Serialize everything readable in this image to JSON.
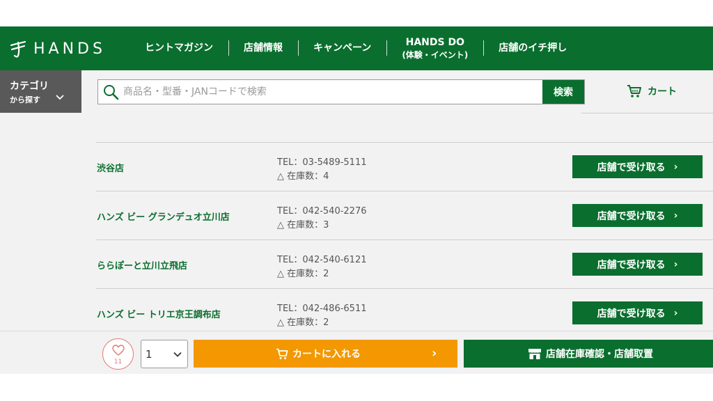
{
  "brand": {
    "logo_text": "HANDS"
  },
  "nav": {
    "items": [
      {
        "label": "ヒントマガジン",
        "sub": ""
      },
      {
        "label": "店舗情報",
        "sub": ""
      },
      {
        "label": "キャンペーン",
        "sub": ""
      },
      {
        "label": "HANDS DO",
        "sub": "(体験・イベント)"
      },
      {
        "label": "店舗のイチ押し",
        "sub": ""
      }
    ]
  },
  "category": {
    "line1": "カテゴリ",
    "line2": "から探す"
  },
  "search": {
    "placeholder": "商品名・型番・JANコードで検索",
    "value": "",
    "button_label": "検索"
  },
  "cart_link": {
    "label": "カート"
  },
  "stores": [
    {
      "name": "渋谷店",
      "tel": "TEL：03-5489-5111",
      "stock": "△ 在庫数：4",
      "button_label": "店舗で受け取る"
    },
    {
      "name": "ハンズ ビー グランデュオ立川店",
      "tel": "TEL：042-540-2276",
      "stock": "△ 在庫数：3",
      "button_label": "店舗で受け取る"
    },
    {
      "name": "ららぽーと立川立飛店",
      "tel": "TEL：042-540-6121",
      "stock": "△ 在庫数：2",
      "button_label": "店舗で受け取る"
    },
    {
      "name": "ハンズ ビー トリエ京王調布店",
      "tel": "TEL：042-486-6511",
      "stock": "△ 在庫数：2",
      "button_label": "店舗で受け取る"
    }
  ],
  "bottom_bar": {
    "favorite_count": "11",
    "quantity": "1",
    "add_to_cart_label": "カートに入れる",
    "store_stock_label": "店舗在庫確認・店舗取置"
  },
  "colors": {
    "brand_green": "#0a6e2e",
    "accent_orange": "#f39800",
    "favorite_pink": "#e07b73"
  },
  "icons": {
    "logo": "hands-hand-logo-icon",
    "search": "magnifier-icon",
    "cart": "shopping-cart-icon",
    "favorite": "heart-icon",
    "store": "storefront-icon"
  }
}
